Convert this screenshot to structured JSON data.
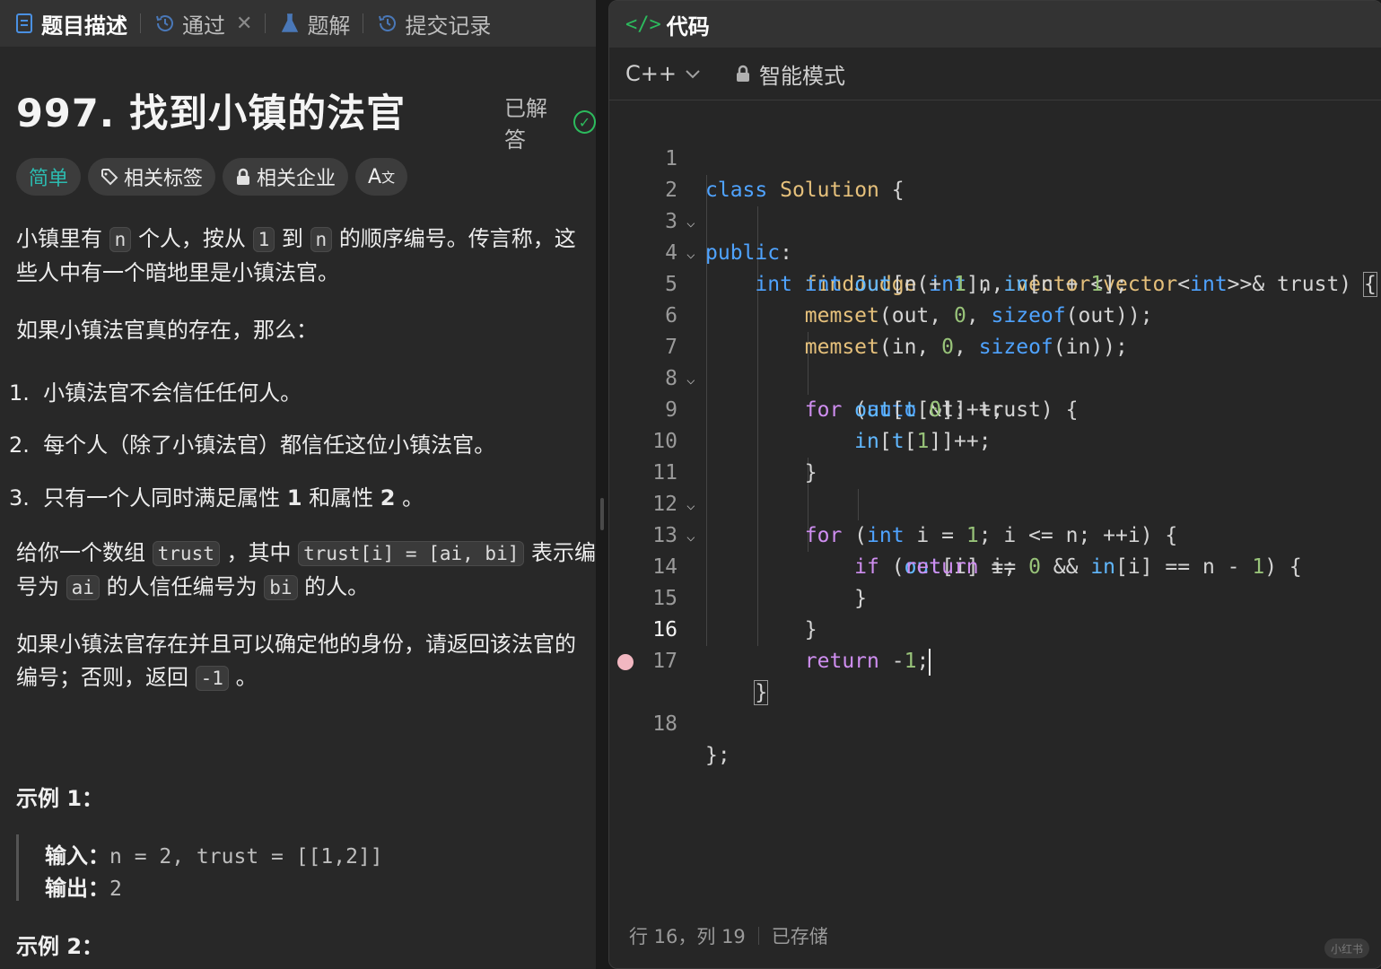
{
  "left_tabs": [
    {
      "label": "题目描述",
      "icon": "document-icon"
    },
    {
      "label": "通过",
      "icon": "history-icon"
    },
    {
      "label": "题解",
      "icon": "flask-icon"
    },
    {
      "label": "提交记录",
      "icon": "history-icon"
    }
  ],
  "problem": {
    "title": "997. 找到小镇的法官",
    "status": "已解答",
    "tags": [
      "简单",
      "相关标签",
      "相关企业",
      "A"
    ],
    "p1": {
      "a": "小镇里有",
      "c1": "n",
      "b": "个人，按从",
      "c2": "1",
      "c": "到",
      "c3": "n",
      "d": "的顺序编号。传言称，这些人中有一个暗地里是小镇法官。"
    },
    "p2": "如果小镇法官真的存在，那么：",
    "rules": [
      {
        "num": "1.",
        "text": "小镇法官不会信任任何人。"
      },
      {
        "num": "2.",
        "text": "每个人（除了小镇法官）都信任这位小镇法官。"
      },
      {
        "num": "3.",
        "pre": "只有一个人同时满足属性",
        "b1": "1",
        "mid": "和属性",
        "b2": "2",
        "post": "。"
      }
    ],
    "p3": {
      "a": "给你一个数组",
      "c1": "trust",
      "b": "，其中",
      "c2": "trust[i] = [ai, bi]",
      "c": "表示编号为",
      "c3": "ai",
      "d": "的人信任编号为",
      "c4": "bi",
      "e": "的人。"
    },
    "p4": {
      "a": "如果小镇法官存在并且可以确定他的身份，请返回该法官的编号；否则，返回",
      "c1": "-1",
      "b": "。"
    },
    "example1": {
      "heading": "示例 1：",
      "input_label": "输入：",
      "input": "n = 2, trust = [[1,2]]",
      "output_label": "输出：",
      "output": "2"
    },
    "example2": {
      "heading": "示例 2："
    }
  },
  "editor": {
    "header": "代码",
    "language": "C++",
    "mode": "智能模式",
    "lines": [
      "1",
      "2",
      "3",
      "4",
      "5",
      "6",
      "7",
      "8",
      "9",
      "10",
      "11",
      "12",
      "13",
      "14",
      "15",
      "16",
      "17",
      "18"
    ],
    "status_pos": "行 16，列 19",
    "status_saved": "已存储"
  },
  "colors": {
    "accent_green": "#2cbb5d",
    "keyword_blue": "#4fa3ff",
    "keyword_purple": "#cf8ef0",
    "class_yellow": "#e5c07b",
    "number_green": "#98c379",
    "easy_teal": "#2cbbb0"
  }
}
